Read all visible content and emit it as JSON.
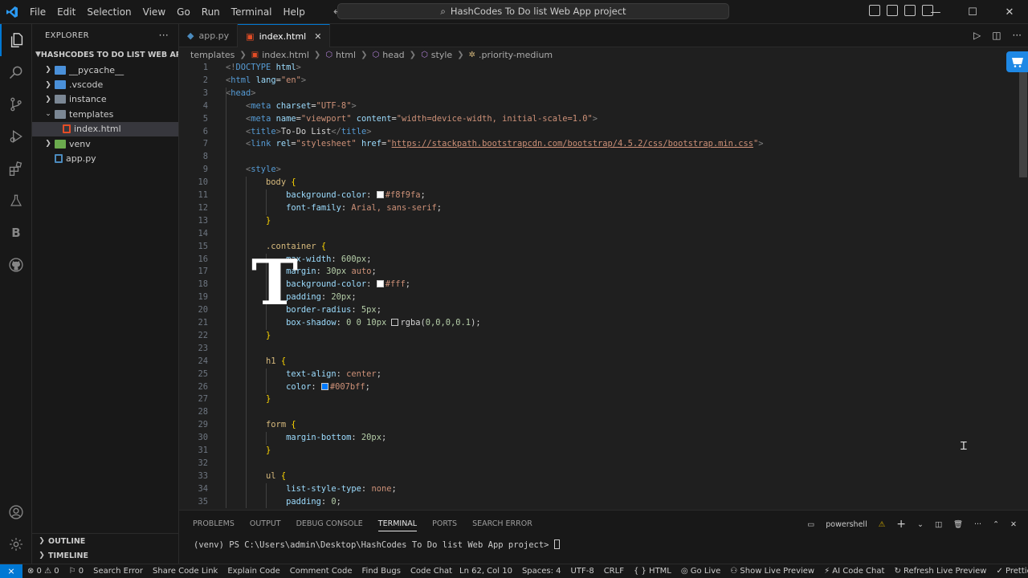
{
  "menu": [
    "File",
    "Edit",
    "Selection",
    "View",
    "Go",
    "Run",
    "Terminal",
    "Help"
  ],
  "command_center": "HashCodes To Do list Web App project",
  "sidebar": {
    "title": "EXPLORER",
    "more": "···",
    "project": "HASHCODES TO DO LIST WEB APP P...",
    "items": [
      {
        "label": "__pycache__",
        "type": "folder"
      },
      {
        "label": ".vscode",
        "type": "folder"
      },
      {
        "label": "instance",
        "type": "folder"
      },
      {
        "label": "templates",
        "type": "folder-open"
      },
      {
        "label": "index.html",
        "type": "html-file"
      },
      {
        "label": "venv",
        "type": "folder"
      },
      {
        "label": "app.py",
        "type": "python-file"
      }
    ],
    "outline": "OUTLINE",
    "timeline": "TIMELINE"
  },
  "tabs": [
    {
      "label": "app.py",
      "active": false
    },
    {
      "label": "index.html",
      "active": true,
      "close": "✕"
    }
  ],
  "breadcrumb": [
    "templates",
    "index.html",
    "html",
    "head",
    "style",
    ".priority-medium"
  ],
  "code_lines": [
    [
      [
        "t-punct",
        "<!"
      ],
      [
        "t-tag",
        "DOCTYPE"
      ],
      [
        "t-text",
        " "
      ],
      [
        "t-attr",
        "html"
      ],
      [
        "t-punct",
        ">"
      ]
    ],
    [
      [
        "t-punct",
        "<"
      ],
      [
        "t-tag",
        "html"
      ],
      [
        "t-text",
        " "
      ],
      [
        "t-attr",
        "lang"
      ],
      [
        "t-text",
        "="
      ],
      [
        "t-str",
        "\"en\""
      ],
      [
        "t-punct",
        ">"
      ]
    ],
    [
      [
        "t-punct",
        "<"
      ],
      [
        "t-tag",
        "head"
      ],
      [
        "t-punct",
        ">"
      ]
    ],
    [
      [
        "t-text",
        "    "
      ],
      [
        "t-punct",
        "<"
      ],
      [
        "t-tag",
        "meta"
      ],
      [
        "t-text",
        " "
      ],
      [
        "t-attr",
        "charset"
      ],
      [
        "t-text",
        "="
      ],
      [
        "t-str",
        "\"UTF-8\""
      ],
      [
        "t-punct",
        ">"
      ]
    ],
    [
      [
        "t-text",
        "    "
      ],
      [
        "t-punct",
        "<"
      ],
      [
        "t-tag",
        "meta"
      ],
      [
        "t-text",
        " "
      ],
      [
        "t-attr",
        "name"
      ],
      [
        "t-text",
        "="
      ],
      [
        "t-str",
        "\"viewport\""
      ],
      [
        "t-text",
        " "
      ],
      [
        "t-attr",
        "content"
      ],
      [
        "t-text",
        "="
      ],
      [
        "t-str",
        "\"width=device-width, initial-scale=1.0\""
      ],
      [
        "t-punct",
        ">"
      ]
    ],
    [
      [
        "t-text",
        "    "
      ],
      [
        "t-punct",
        "<"
      ],
      [
        "t-tag",
        "title"
      ],
      [
        "t-punct",
        ">"
      ],
      [
        "t-text",
        "To-Do List"
      ],
      [
        "t-punct",
        "</"
      ],
      [
        "t-tag",
        "title"
      ],
      [
        "t-punct",
        ">"
      ]
    ],
    [
      [
        "t-text",
        "    "
      ],
      [
        "t-punct",
        "<"
      ],
      [
        "t-tag",
        "link"
      ],
      [
        "t-text",
        " "
      ],
      [
        "t-attr",
        "rel"
      ],
      [
        "t-text",
        "="
      ],
      [
        "t-str",
        "\"stylesheet\""
      ],
      [
        "t-text",
        " "
      ],
      [
        "t-attr",
        "href"
      ],
      [
        "t-text",
        "="
      ],
      [
        "t-str",
        "\""
      ],
      [
        "t-str link",
        "https://stackpath.bootstrapcdn.com/bootstrap/4.5.2/css/bootstrap.min.css"
      ],
      [
        "t-str",
        "\""
      ],
      [
        "t-punct",
        ">"
      ]
    ],
    [],
    [
      [
        "t-text",
        "    "
      ],
      [
        "t-punct",
        "<"
      ],
      [
        "t-tag",
        "style"
      ],
      [
        "t-punct",
        ">"
      ]
    ],
    [
      [
        "t-text",
        "        "
      ],
      [
        "t-sel",
        "body"
      ],
      [
        "t-text",
        " "
      ],
      [
        "t-brace",
        "{"
      ]
    ],
    [
      [
        "t-text",
        "            "
      ],
      [
        "t-prop",
        "background-color"
      ],
      [
        "t-text",
        ": "
      ],
      [
        "swatch",
        "#f8f9fa"
      ],
      [
        "t-val",
        "#f8f9fa"
      ],
      [
        "t-text",
        ";"
      ]
    ],
    [
      [
        "t-text",
        "            "
      ],
      [
        "t-prop",
        "font-family"
      ],
      [
        "t-text",
        ": "
      ],
      [
        "t-val",
        "Arial, sans-serif"
      ],
      [
        "t-text",
        ";"
      ]
    ],
    [
      [
        "t-text",
        "        "
      ],
      [
        "t-brace",
        "}"
      ]
    ],
    [],
    [
      [
        "t-text",
        "        "
      ],
      [
        "t-sel",
        ".container"
      ],
      [
        "t-text",
        " "
      ],
      [
        "t-brace",
        "{"
      ]
    ],
    [
      [
        "t-text",
        "            "
      ],
      [
        "t-prop",
        "max-width"
      ],
      [
        "t-text",
        ": "
      ],
      [
        "t-num",
        "600px"
      ],
      [
        "t-text",
        ";"
      ]
    ],
    [
      [
        "t-text",
        "            "
      ],
      [
        "t-prop",
        "margin"
      ],
      [
        "t-text",
        ": "
      ],
      [
        "t-num",
        "30px"
      ],
      [
        "t-text",
        " "
      ],
      [
        "t-val",
        "auto"
      ],
      [
        "t-text",
        ";"
      ]
    ],
    [
      [
        "t-text",
        "            "
      ],
      [
        "t-prop",
        "background-color"
      ],
      [
        "t-text",
        ": "
      ],
      [
        "swatch",
        "#ffffff"
      ],
      [
        "t-val",
        "#fff"
      ],
      [
        "t-text",
        ";"
      ]
    ],
    [
      [
        "t-text",
        "            "
      ],
      [
        "t-prop",
        "padding"
      ],
      [
        "t-text",
        ": "
      ],
      [
        "t-num",
        "20px"
      ],
      [
        "t-text",
        ";"
      ]
    ],
    [
      [
        "t-text",
        "            "
      ],
      [
        "t-prop",
        "border-radius"
      ],
      [
        "t-text",
        ": "
      ],
      [
        "t-num",
        "5px"
      ],
      [
        "t-text",
        ";"
      ]
    ],
    [
      [
        "t-text",
        "            "
      ],
      [
        "t-prop",
        "box-shadow"
      ],
      [
        "t-text",
        ": "
      ],
      [
        "t-num",
        "0 0 10px"
      ],
      [
        "t-text",
        " "
      ],
      [
        "swatch",
        "#1f1f1f"
      ],
      [
        "t-text",
        "rgba("
      ],
      [
        "t-num",
        "0,0,0,0.1"
      ],
      [
        "t-text",
        ");"
      ]
    ],
    [
      [
        "t-text",
        "        "
      ],
      [
        "t-brace",
        "}"
      ]
    ],
    [],
    [
      [
        "t-text",
        "        "
      ],
      [
        "t-sel",
        "h1"
      ],
      [
        "t-text",
        " "
      ],
      [
        "t-brace",
        "{"
      ]
    ],
    [
      [
        "t-text",
        "            "
      ],
      [
        "t-prop",
        "text-align"
      ],
      [
        "t-text",
        ": "
      ],
      [
        "t-val",
        "center"
      ],
      [
        "t-text",
        ";"
      ]
    ],
    [
      [
        "t-text",
        "            "
      ],
      [
        "t-prop",
        "color"
      ],
      [
        "t-text",
        ": "
      ],
      [
        "swatch",
        "#007bff"
      ],
      [
        "t-val",
        "#007bff"
      ],
      [
        "t-text",
        ";"
      ]
    ],
    [
      [
        "t-text",
        "        "
      ],
      [
        "t-brace",
        "}"
      ]
    ],
    [],
    [
      [
        "t-text",
        "        "
      ],
      [
        "t-sel",
        "form"
      ],
      [
        "t-text",
        " "
      ],
      [
        "t-brace",
        "{"
      ]
    ],
    [
      [
        "t-text",
        "            "
      ],
      [
        "t-prop",
        "margin-bottom"
      ],
      [
        "t-text",
        ": "
      ],
      [
        "t-num",
        "20px"
      ],
      [
        "t-text",
        ";"
      ]
    ],
    [
      [
        "t-text",
        "        "
      ],
      [
        "t-brace",
        "}"
      ]
    ],
    [],
    [
      [
        "t-text",
        "        "
      ],
      [
        "t-sel",
        "ul"
      ],
      [
        "t-text",
        " "
      ],
      [
        "t-brace",
        "{"
      ]
    ],
    [
      [
        "t-text",
        "            "
      ],
      [
        "t-prop",
        "list-style-type"
      ],
      [
        "t-text",
        ": "
      ],
      [
        "t-val",
        "none"
      ],
      [
        "t-text",
        ";"
      ]
    ],
    [
      [
        "t-text",
        "            "
      ],
      [
        "t-prop",
        "padding"
      ],
      [
        "t-text",
        ": "
      ],
      [
        "t-num",
        "0"
      ],
      [
        "t-text",
        ";"
      ]
    ],
    [
      [
        "t-text",
        "        "
      ],
      [
        "t-brace",
        "}"
      ]
    ]
  ],
  "overlay_letter": "T",
  "panel": {
    "tabs": [
      "PROBLEMS",
      "OUTPUT",
      "DEBUG CONSOLE",
      "TERMINAL",
      "PORTS",
      "SEARCH ERROR"
    ],
    "active_tab": "TERMINAL",
    "shell": "powershell",
    "terminal_line": "(venv) PS C:\\Users\\admin\\Desktop\\HashCodes To Do list Web App project> "
  },
  "status": {
    "left": [
      {
        "icon": "error-icon",
        "text": "⊗ 0 ⚠ 0"
      },
      {
        "icon": "ports-icon",
        "text": "⚐ 0"
      },
      {
        "icon": "",
        "text": "Search Error"
      },
      {
        "icon": "",
        "text": "Share Code Link"
      },
      {
        "icon": "",
        "text": "Explain Code"
      },
      {
        "icon": "",
        "text": "Comment Code"
      },
      {
        "icon": "",
        "text": "Find Bugs"
      },
      {
        "icon": "",
        "text": "Code Chat"
      }
    ],
    "right": [
      "Ln 62, Col 10",
      "Spaces: 4",
      "UTF-8",
      "CRLF",
      "{ } HTML",
      "◎ Go Live",
      "⚇ Show Live Preview",
      "⚡ AI Code Chat",
      "↻ Refresh Live Preview",
      "✓ Prettier"
    ]
  },
  "colors": {
    "accent": "#0078d4",
    "editor_bg": "#1f1f1f",
    "chrome_bg": "#181818"
  }
}
